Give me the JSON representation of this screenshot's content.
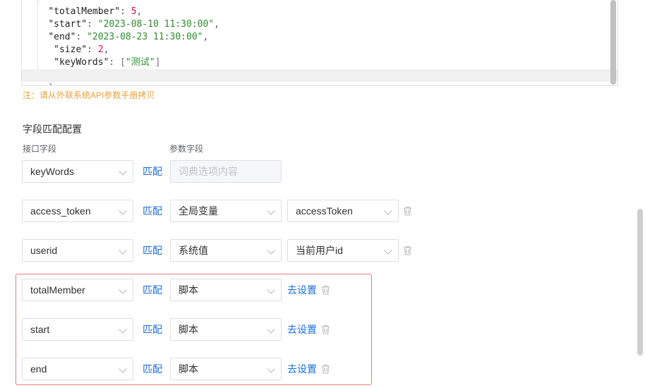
{
  "code": {
    "lines": [
      {
        "indent": "    ",
        "key": "\"totalMember\"",
        "sep": ": ",
        "value": "5",
        "vtype": "n",
        "trail": ","
      },
      {
        "indent": "    ",
        "key": "\"start\"",
        "sep": ": ",
        "value": "\"2023-08-10 11:30:00\"",
        "vtype": "s",
        "trail": ","
      },
      {
        "indent": "    ",
        "key": "\"end\"",
        "sep": ": ",
        "value": "\"2023-08-23 11:30:00\"",
        "vtype": "s",
        "trail": ","
      },
      {
        "indent": "     ",
        "key": "\"size\"",
        "sep": ": ",
        "value": "2",
        "vtype": "n",
        "trail": ","
      },
      {
        "indent": "     ",
        "key": "\"keyWords\"",
        "sep": ": ",
        "value": "\"测试\"",
        "vtype": "s",
        "trail": "",
        "open": "[",
        "close": "]"
      }
    ],
    "closing_brace": "}"
  },
  "note": "注：请从外联系统API参数手册拷贝",
  "section_title": "字段匹配配置",
  "col_labels": {
    "interface_field": "接口字段",
    "param_field": "参数字段"
  },
  "match_label": "匹配",
  "go_setting_label": "去设置",
  "rows": [
    {
      "field": "keyWords",
      "type": "",
      "type_placeholder": "词典选项内容",
      "value": "",
      "action": "none"
    },
    {
      "field": "access_token",
      "type": "全局变量",
      "value": "accessToken",
      "action": "select"
    },
    {
      "field": "userid",
      "type": "系统值",
      "value": "当前用户id",
      "action": "select"
    },
    {
      "field": "totalMember",
      "type": "脚本",
      "value": "",
      "action": "link"
    },
    {
      "field": "start",
      "type": "脚本",
      "value": "",
      "action": "link"
    },
    {
      "field": "end",
      "type": "脚本",
      "value": "",
      "action": "link"
    }
  ],
  "colors": {
    "link": "#1e6fd9",
    "note": "#e6a23c",
    "highlight": "#e8787a"
  }
}
